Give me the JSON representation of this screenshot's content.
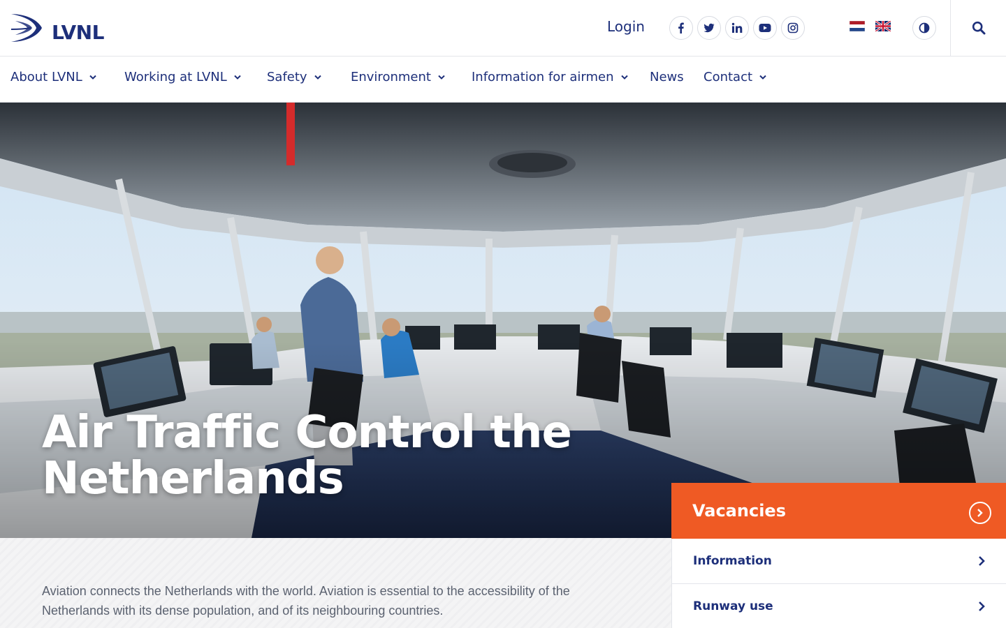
{
  "brand": {
    "name": "LVNL",
    "primary": "#1d2f7a",
    "accent": "#ef5a24"
  },
  "header": {
    "login_label": "Login",
    "social": [
      "facebook-icon",
      "twitter-icon",
      "linkedin-icon",
      "youtube-icon",
      "instagram-icon"
    ],
    "languages": [
      "nl-flag",
      "en-flag"
    ],
    "contrast_icon": "contrast-icon",
    "search_icon": "search-icon"
  },
  "nav": {
    "items": [
      {
        "label": "About LVNL",
        "has_menu": true
      },
      {
        "label": "Working at LVNL",
        "has_menu": true
      },
      {
        "label": "Safety",
        "has_menu": true
      },
      {
        "label": "Environment",
        "has_menu": true
      },
      {
        "label": "Information for airmen",
        "has_menu": true
      },
      {
        "label": "News",
        "has_menu": false
      },
      {
        "label": "Contact",
        "has_menu": true
      }
    ]
  },
  "hero": {
    "title": "Air Traffic Control the Netherlands"
  },
  "intro": {
    "text": "Aviation connects the Netherlands with the world. Aviation is essential to the accessibility of the Netherlands with its dense population, and of its neighbouring countries."
  },
  "sidebar": {
    "vacancies_label": "Vacancies",
    "links": [
      {
        "label": "Information"
      },
      {
        "label": "Runway use"
      }
    ]
  }
}
